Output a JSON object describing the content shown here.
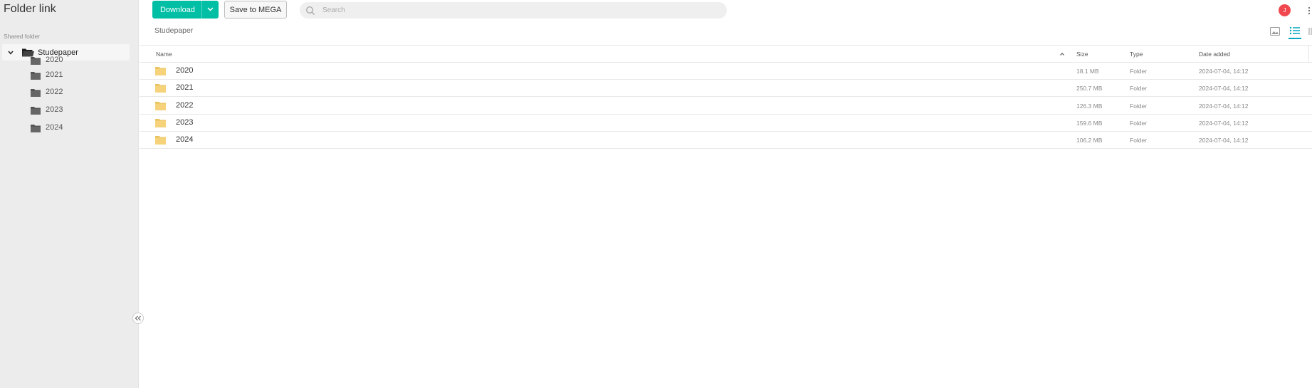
{
  "sidebar": {
    "title": "Folder link",
    "section_label": "Shared folder",
    "root": {
      "label": "Studepaper"
    },
    "children": [
      {
        "label": "2020"
      },
      {
        "label": "2021"
      },
      {
        "label": "2022"
      },
      {
        "label": "2023"
      },
      {
        "label": "2024"
      }
    ]
  },
  "toolbar": {
    "download_label": "Download",
    "save_label": "Save to MEGA",
    "search_placeholder": "Search",
    "avatar_initial": "J"
  },
  "breadcrumb": {
    "current": "Studepaper"
  },
  "table": {
    "columns": {
      "name": "Name",
      "size": "Size",
      "type": "Type",
      "date": "Date added"
    },
    "rows": [
      {
        "name": "2020",
        "size": "18.1 MB",
        "type": "Folder",
        "date": "2024-07-04, 14:12"
      },
      {
        "name": "2021",
        "size": "250.7 MB",
        "type": "Folder",
        "date": "2024-07-04, 14:12"
      },
      {
        "name": "2022",
        "size": "126.3 MB",
        "type": "Folder",
        "date": "2024-07-04, 14:12"
      },
      {
        "name": "2023",
        "size": "159.6 MB",
        "type": "Folder",
        "date": "2024-07-04, 14:12"
      },
      {
        "name": "2024",
        "size": "106.2 MB",
        "type": "Folder",
        "date": "2024-07-04, 14:12"
      }
    ]
  },
  "colors": {
    "accent": "#00bfa5",
    "avatar": "#f0484e",
    "folder_yellow": "#f6d37a",
    "sidebar_bg": "#ececec",
    "view_active": "#00a6c4"
  },
  "icons": {
    "sidebar_folder": "dark-folder-icon",
    "row_folder": "yellow-folder-icon",
    "search": "search-icon",
    "collapse": "double-chevron-left-icon"
  }
}
